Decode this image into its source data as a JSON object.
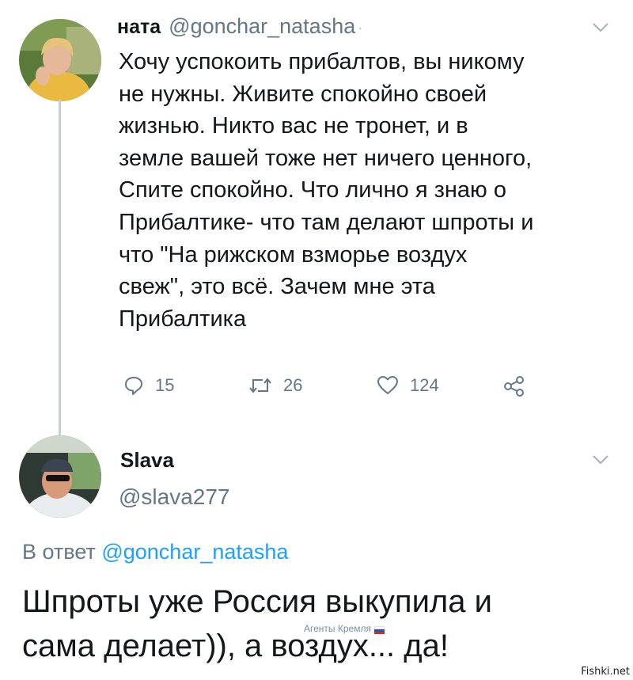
{
  "tweet1": {
    "display_name": "ната",
    "handle": "@gonchar_natasha",
    "separator": "·",
    "lines": [
      "Хочу успокоить прибалтов, вы никому",
      "не нужны. Живите спокойно своей",
      "жизнью. Никто вас не тронет, и в",
      "земле вашей тоже нет ничего ценного,",
      "Спите спокойно. Что лично я знаю о",
      "Прибалтике- что там делают шпроты и",
      "что \"На рижском взморье воздух",
      "свеж\", это всё. Зачем мне эта",
      "Прибалтика"
    ],
    "replies_count": "15",
    "retweets_count": "26",
    "likes_count": "124"
  },
  "tweet2": {
    "display_name": "Slava",
    "handle": "@slava277",
    "reply_prefix": "В ответ",
    "reply_handle": "@gonchar_natasha",
    "lines": [
      "Шпроты уже Россия выкупила и",
      "сама делает)), а воздух... да!"
    ]
  },
  "watermark": "Агенты Кремля",
  "site_mark": "Fishki.net",
  "colors": {
    "text": "#14171a",
    "secondary": "#657786",
    "link": "#1da1f2",
    "thread_line": "#c4cfd6"
  },
  "icons": {
    "reply": "reply-icon",
    "retweet": "retweet-icon",
    "like": "heart-icon",
    "share": "share-icon",
    "menu": "chevron-down-icon"
  }
}
